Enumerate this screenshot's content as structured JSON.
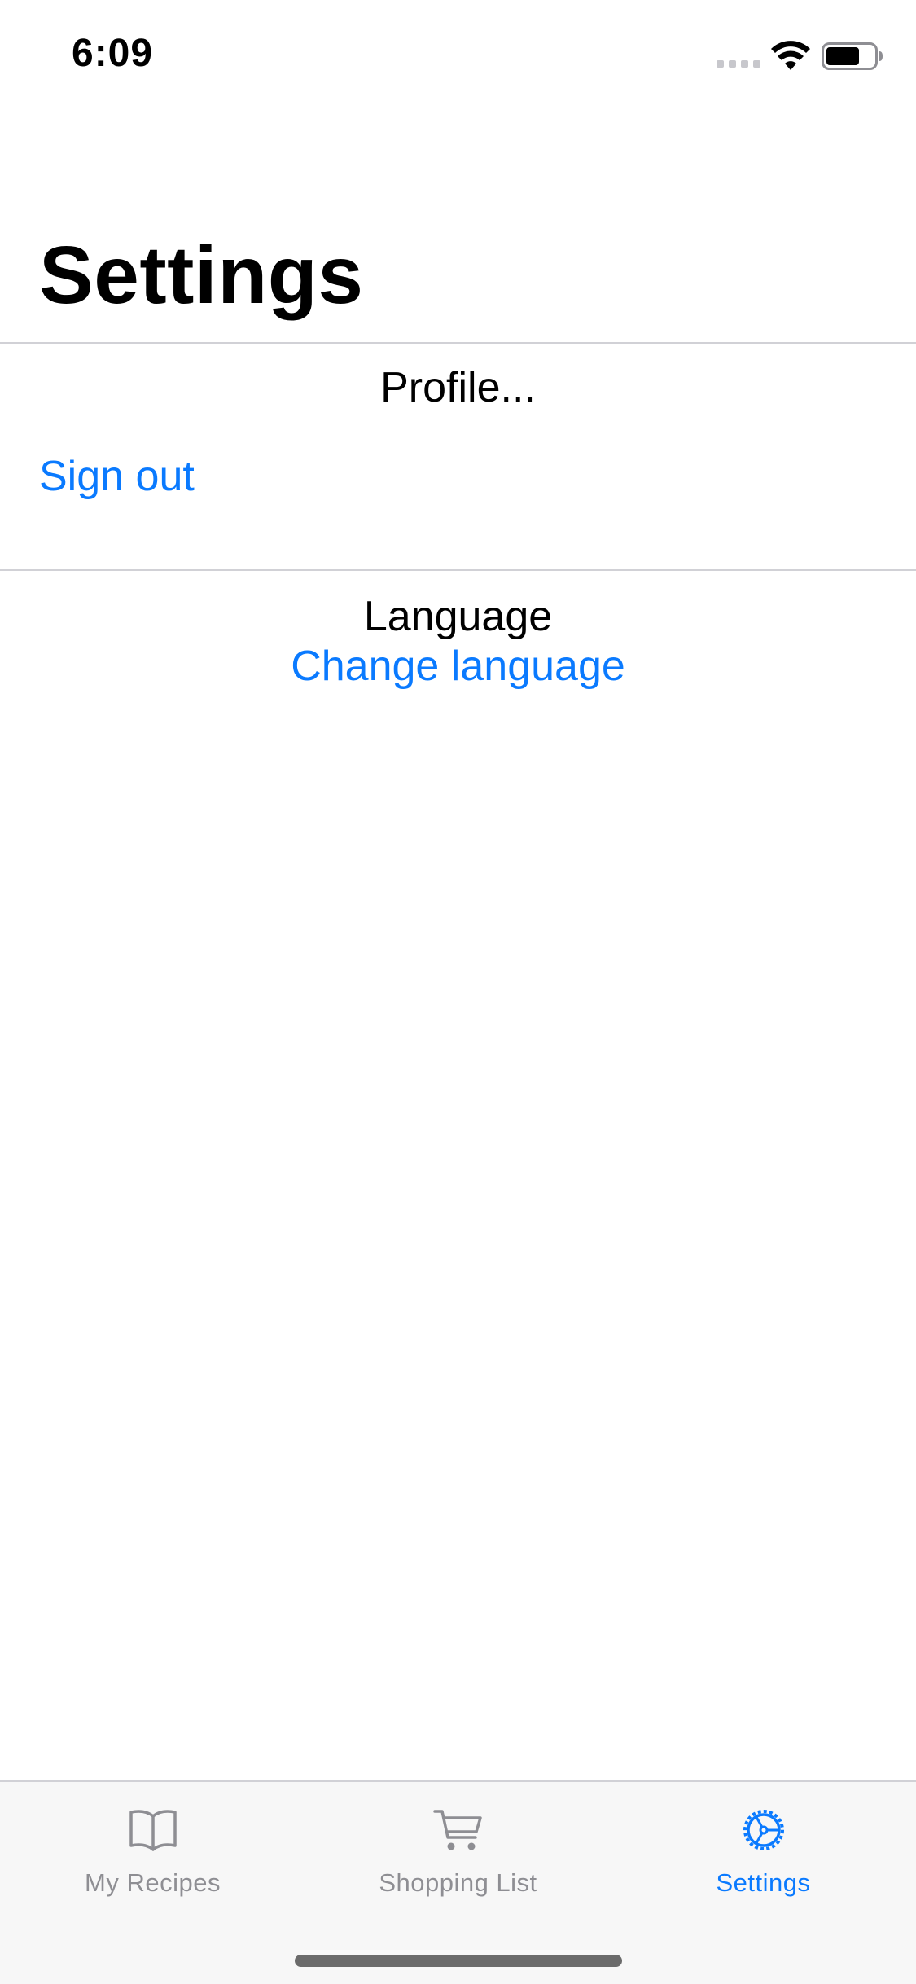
{
  "status_bar": {
    "time": "6:09",
    "icons": [
      "signal-icon",
      "wifi-icon",
      "battery-icon"
    ]
  },
  "page": {
    "title": "Settings"
  },
  "sections": {
    "profile": {
      "header": "Profile...",
      "sign_out_label": "Sign out"
    },
    "language": {
      "header": "Language",
      "change_label": "Change language"
    }
  },
  "tab_bar": {
    "tabs": [
      {
        "label": "My Recipes",
        "icon": "book-icon",
        "active": false
      },
      {
        "label": "Shopping List",
        "icon": "cart-icon",
        "active": false
      },
      {
        "label": "Settings",
        "icon": "gear-icon",
        "active": true
      }
    ]
  },
  "colors": {
    "accent": "#0a7aff",
    "inactive_tab": "#8e8e93",
    "tab_bar_background": "#f7f7f7",
    "divider": "#d1d1d6"
  }
}
